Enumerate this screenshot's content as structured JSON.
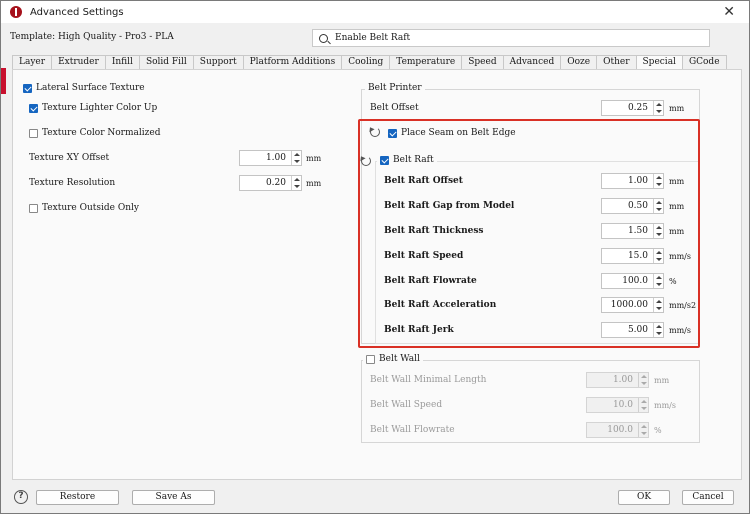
{
  "window": {
    "title": "Advanced Settings",
    "close": "✕"
  },
  "template": {
    "label": "Template: High Quality - Pro3 - PLA"
  },
  "search": {
    "value": "Enable Belt Raft"
  },
  "tabs": [
    "Layer",
    "Extruder",
    "Infill",
    "Solid Fill",
    "Support",
    "Platform Additions",
    "Cooling",
    "Temperature",
    "Speed",
    "Advanced",
    "Ooze",
    "Other",
    "Special",
    "GCode"
  ],
  "active_tab": "Special",
  "lateral": {
    "title": "Lateral Surface Texture",
    "lighter": "Texture Lighter Color Up",
    "normalized": "Texture Color Normalized",
    "xy_label": "Texture XY Offset",
    "xy_value": "1.00",
    "xy_unit": "mm",
    "res_label": "Texture Resolution",
    "res_value": "0.20",
    "res_unit": "mm",
    "outside": "Texture Outside Only"
  },
  "belt_printer": {
    "title": "Belt Printer",
    "offset_label": "Belt Offset",
    "offset_value": "0.25",
    "offset_unit": "mm",
    "seam_label": "Place Seam on Belt Edge"
  },
  "belt_raft": {
    "title": "Belt Raft",
    "rows": [
      {
        "label": "Belt Raft Offset",
        "value": "1.00",
        "unit": "mm"
      },
      {
        "label": "Belt Raft Gap from Model",
        "value": "0.50",
        "unit": "mm"
      },
      {
        "label": "Belt Raft Thickness",
        "value": "1.50",
        "unit": "mm"
      },
      {
        "label": "Belt Raft Speed",
        "value": "15.0",
        "unit": "mm/s"
      },
      {
        "label": "Belt Raft Flowrate",
        "value": "100.0",
        "unit": "%"
      },
      {
        "label": "Belt Raft Acceleration",
        "value": "1000.00",
        "unit": "mm/s2"
      },
      {
        "label": "Belt Raft Jerk",
        "value": "5.00",
        "unit": "mm/s"
      }
    ]
  },
  "belt_wall": {
    "title": "Belt Wall",
    "rows": [
      {
        "label": "Belt Wall Minimal Length",
        "value": "1.00",
        "unit": "mm"
      },
      {
        "label": "Belt Wall Speed",
        "value": "10.0",
        "unit": "mm/s"
      },
      {
        "label": "Belt Wall Flowrate",
        "value": "100.0",
        "unit": "%"
      }
    ]
  },
  "footer": {
    "help": "?",
    "restore": "Restore",
    "save_as": "Save As",
    "ok": "OK",
    "cancel": "Cancel"
  },
  "colors": {
    "accent": "#1565c0",
    "highlight_box": "#d93025",
    "brand": "#a6121c"
  }
}
